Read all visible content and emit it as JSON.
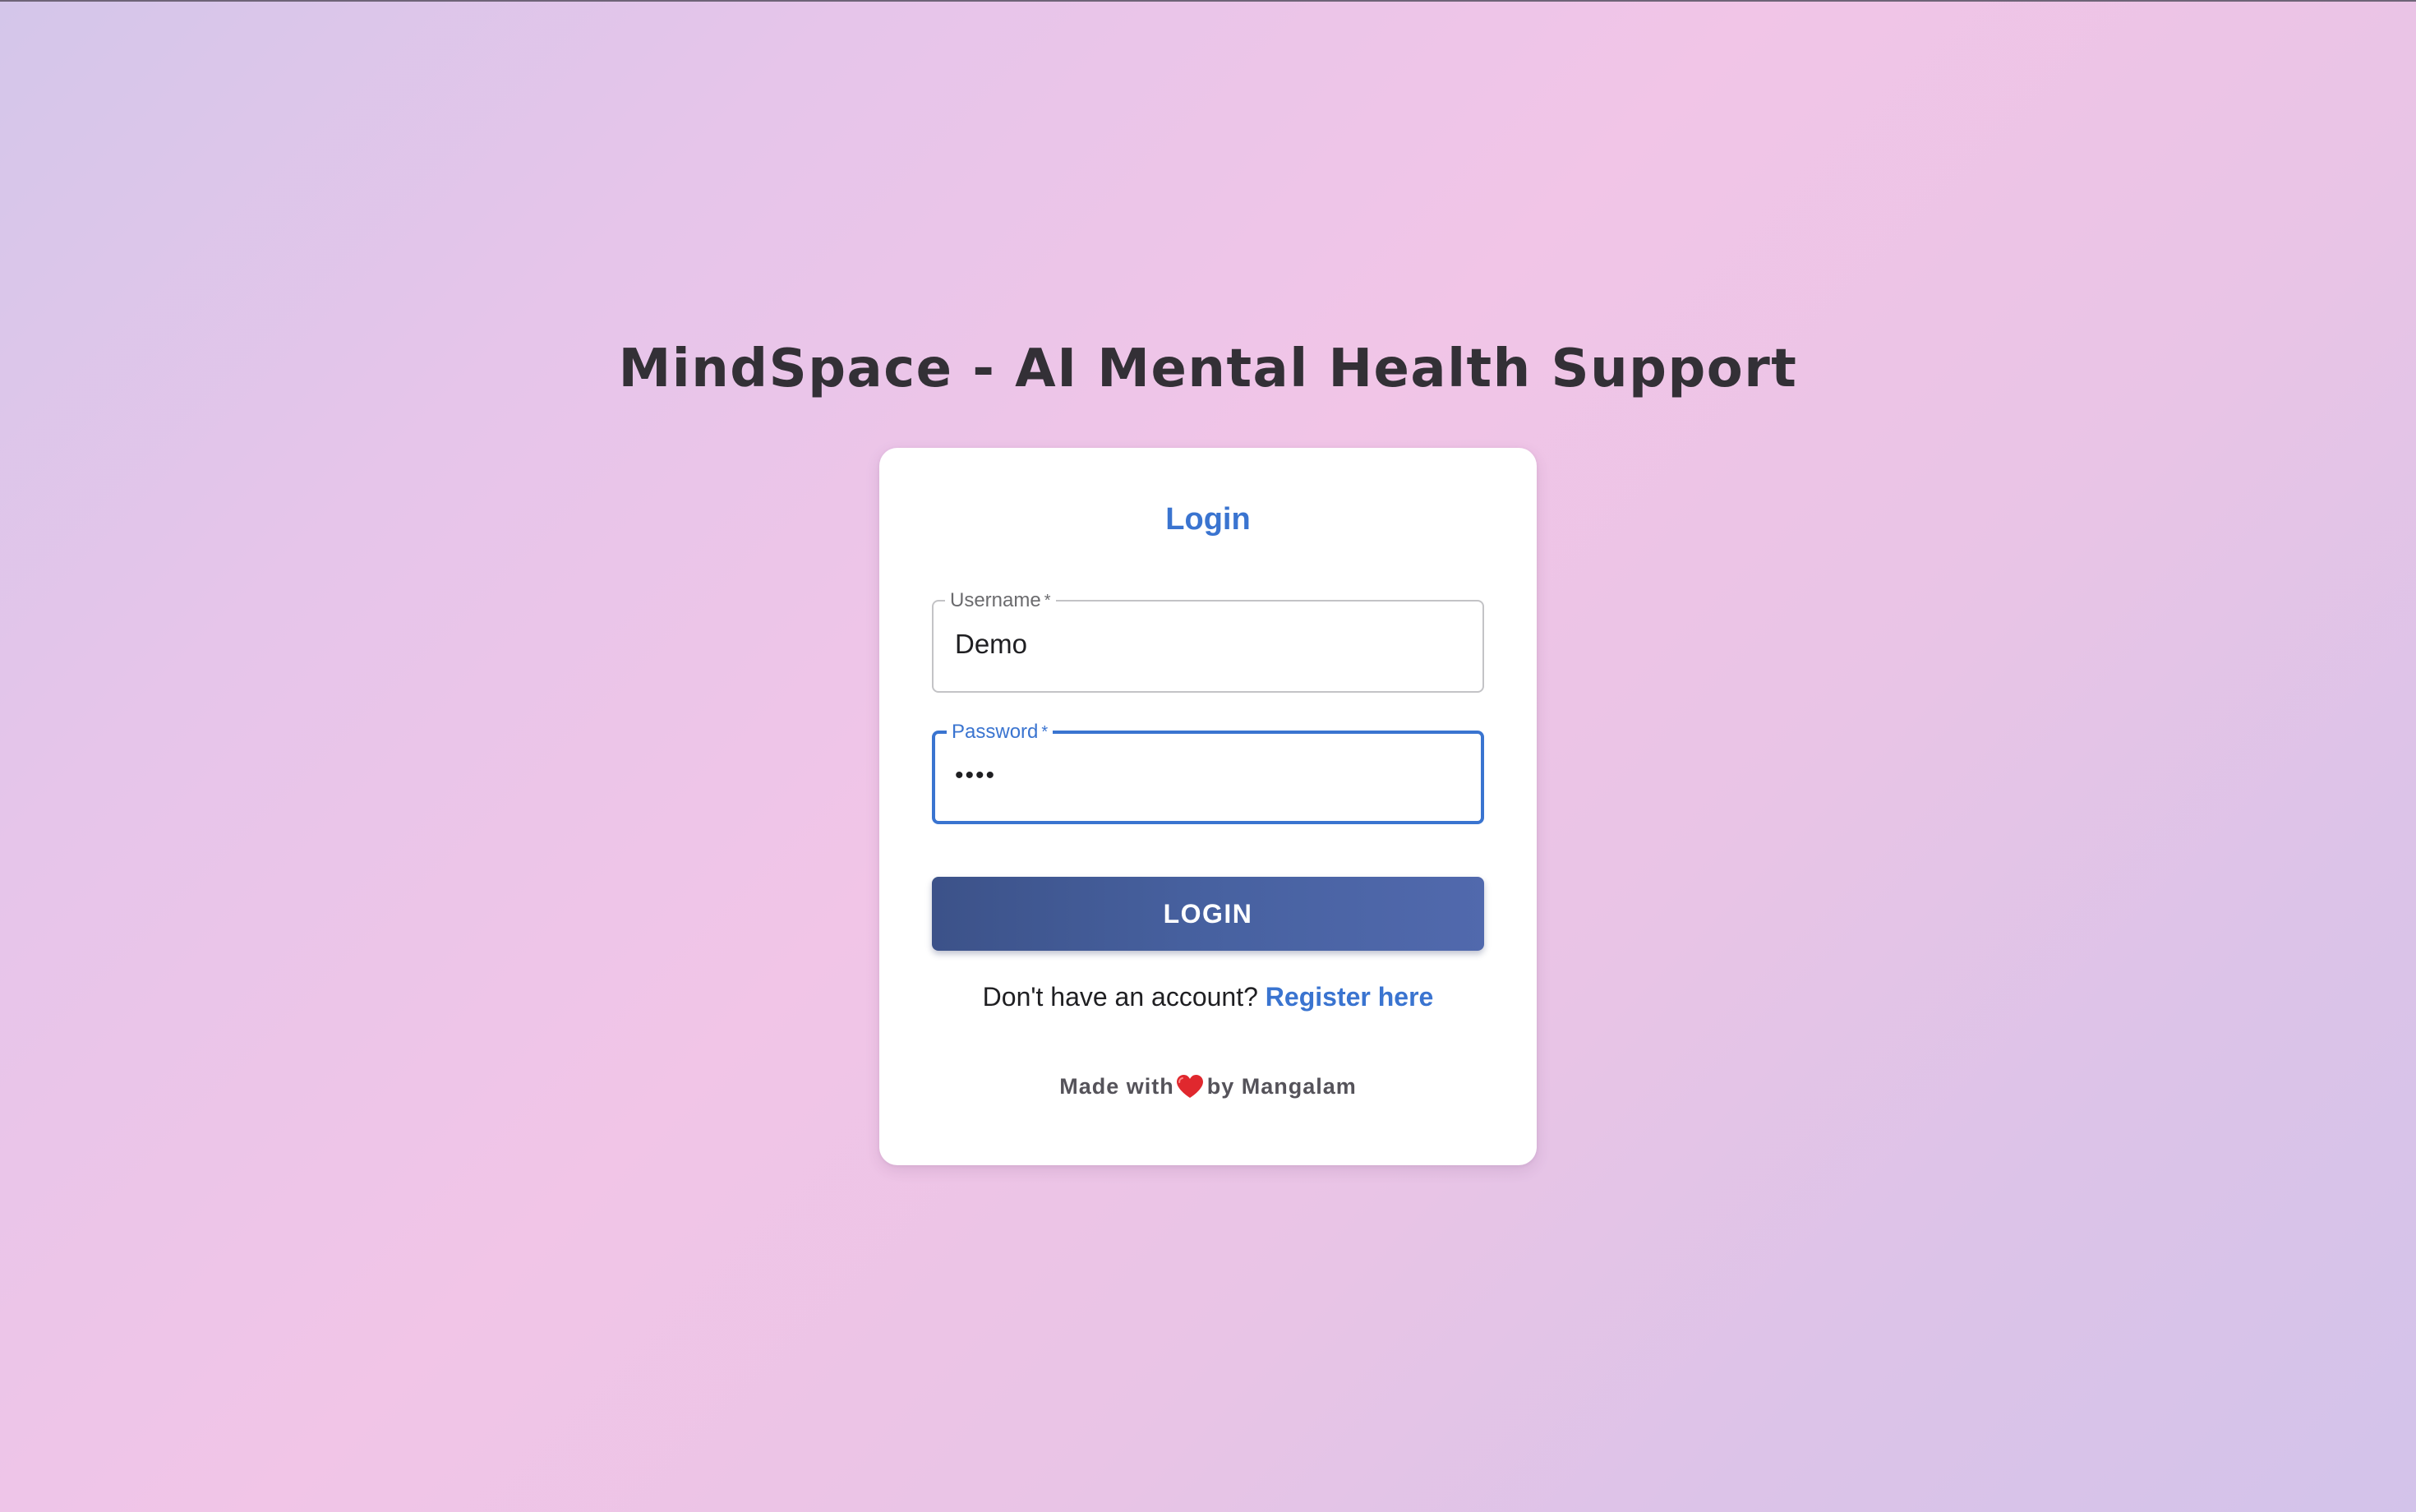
{
  "app": {
    "title": "MindSpace - AI Mental Health Support"
  },
  "login_card": {
    "heading": "Login",
    "username": {
      "label": "Username",
      "required_mark": "*",
      "value": "Demo"
    },
    "password": {
      "label": "Password",
      "required_mark": "*",
      "value": "••••"
    },
    "submit_label": "LOGIN",
    "register_prompt": "Don't have an account?",
    "register_link": "Register here",
    "footer_prefix": "Made with",
    "footer_icon": "heart-icon",
    "footer_suffix": "by Mangalam"
  },
  "colors": {
    "accent": "#3a74d0",
    "button": "#4761a0",
    "heart": "#e0282e"
  }
}
